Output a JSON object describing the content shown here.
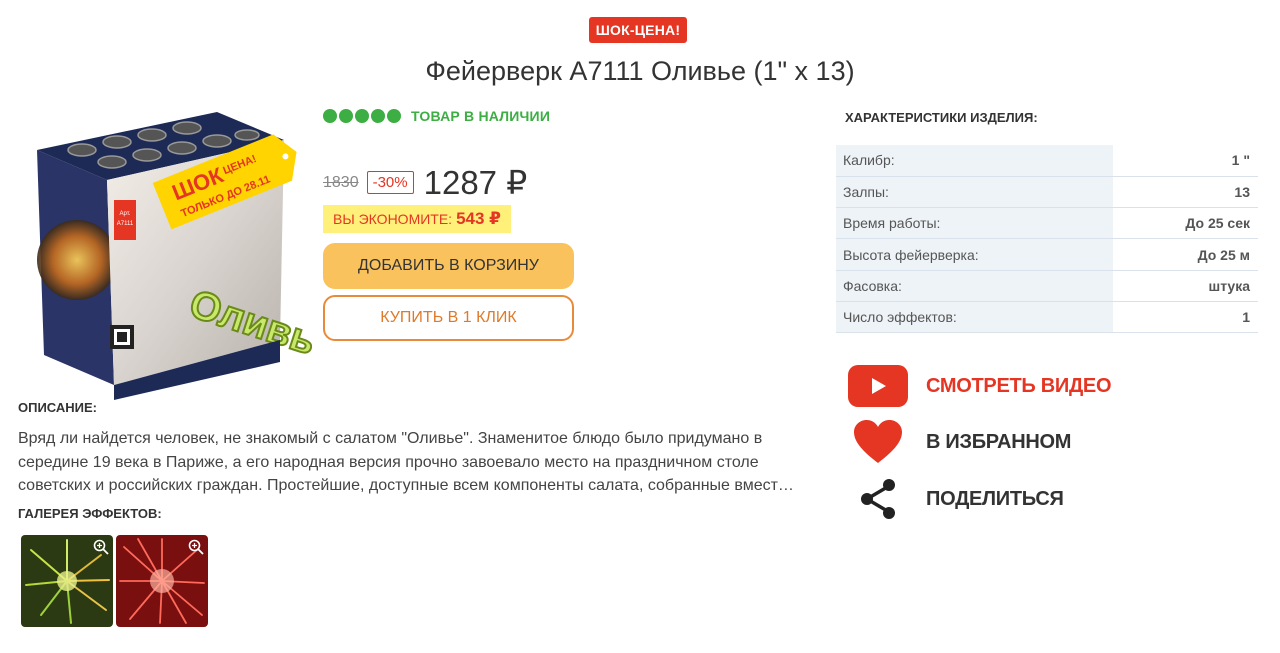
{
  "badge": "ШОК-ЦЕНА!",
  "title": "Фейерверк А7111 Оливье (1\" х 13)",
  "image": {
    "alt": "Фейерверк Оливье",
    "box_text": "Оливье",
    "sticker_line1": "ШОК ЦЕНА!",
    "sticker_line2": "ТОЛЬКО ДО 28.11",
    "art": "Арт. А7111"
  },
  "stock": {
    "label": "ТОВАР В НАЛИЧИИ",
    "rating_dots": 5
  },
  "price": {
    "old": "1830",
    "discount": "-30%",
    "current": "1287 ₽",
    "save_label": "ВЫ ЭКОНОМИТЕ:",
    "save_value": "543 ₽"
  },
  "buttons": {
    "cart": "ДОБАВИТЬ В КОРЗИНУ",
    "buy_one_click": "КУПИТЬ В 1 КЛИК"
  },
  "description": {
    "heading": "ОПИСАНИЕ:",
    "text": "Вряд ли найдется человек, не знакомый с салатом \"Оливье\". Знаменитое блюдо было придумано в середине 19 века в Париже, а его народная версия прочно завоевало место на праздничном столе советских и российских граждан. Простейшие, доступные всем компоненты салата, собранные вмест…"
  },
  "gallery": {
    "heading": "ГАЛЕРЕЯ ЭФФЕКТОВ:"
  },
  "specs": {
    "heading": "ХАРАКТЕРИСТИКИ ИЗДЕЛИЯ:",
    "rows": [
      {
        "key": "Калибр:",
        "value": "1 \""
      },
      {
        "key": "Залпы:",
        "value": "13"
      },
      {
        "key": "Время работы:",
        "value": "До 25 сек"
      },
      {
        "key": "Высота фейерверка:",
        "value": "До 25 м"
      },
      {
        "key": "Фасовка:",
        "value": "штука"
      },
      {
        "key": "Число эффектов:",
        "value": "1"
      }
    ]
  },
  "actions": {
    "video": "СМОТРЕТЬ ВИДЕО",
    "favorite": "В ИЗБРАННОМ",
    "share": "ПОДЕЛИТЬСЯ"
  },
  "colors": {
    "accent_red": "#e53523",
    "green": "#3cae43",
    "cart_yellow": "#f9c25d",
    "buy_orange": "#e88a3a"
  }
}
